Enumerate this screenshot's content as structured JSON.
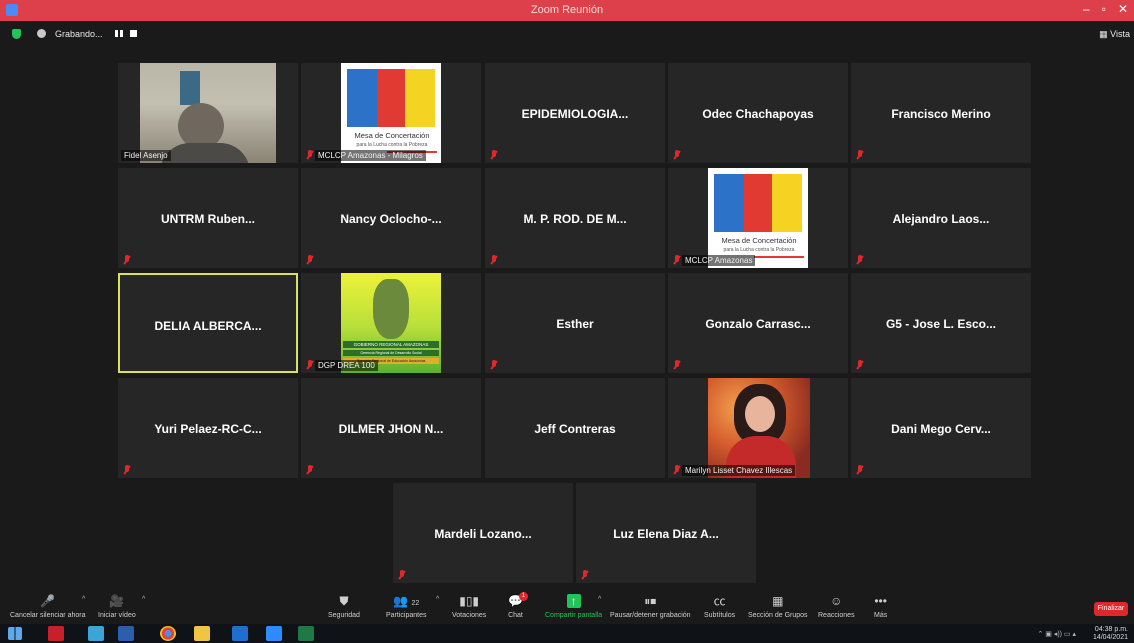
{
  "window": {
    "title": "Zoom Reunión",
    "controls": [
      "–",
      "▫",
      "✕"
    ]
  },
  "topbar": {
    "recording_text": "Grabando...",
    "view_label": "Vista"
  },
  "tiles": [
    {
      "id": "fidel",
      "type": "video",
      "label": "Fidel Asenjo",
      "muted": false
    },
    {
      "id": "mclcp-milagros",
      "type": "logo-mesa",
      "label": "MCLCP Amazonas - Milagros",
      "muted": true
    },
    {
      "id": "epidemiologia",
      "type": "name",
      "name": "EPIDEMIOLOGIA...",
      "muted": true
    },
    {
      "id": "odec",
      "type": "name",
      "name": "Odec Chachapoyas",
      "muted": true
    },
    {
      "id": "francisco",
      "type": "name",
      "name": "Francisco Merino",
      "muted": true
    },
    {
      "id": "untrm",
      "type": "name",
      "name": "UNTRM Ruben...",
      "muted": true
    },
    {
      "id": "nancy",
      "type": "name",
      "name": "Nancy Oclocho-...",
      "muted": true
    },
    {
      "id": "mprod",
      "type": "name",
      "name": "M. P. ROD. DE M...",
      "muted": true
    },
    {
      "id": "mclcp-amazonas",
      "type": "logo-mesa",
      "label": "MCLCP Amazonas",
      "muted": true
    },
    {
      "id": "alejandro",
      "type": "name",
      "name": "Alejandro Laos...",
      "muted": true
    },
    {
      "id": "delia",
      "type": "name",
      "name": "DELIA ALBERCA...",
      "muted": false,
      "active": true
    },
    {
      "id": "dgp",
      "type": "logo-gob",
      "label": "DGP DREA 100",
      "muted": true
    },
    {
      "id": "esther",
      "type": "name",
      "name": "Esther",
      "muted": true
    },
    {
      "id": "gonzalo",
      "type": "name",
      "name": "Gonzalo Carrasc...",
      "muted": true
    },
    {
      "id": "g5",
      "type": "name",
      "name": "G5 - Jose L. Esco...",
      "muted": true
    },
    {
      "id": "yuri",
      "type": "name",
      "name": "Yuri Pelaez-RC-C...",
      "muted": true
    },
    {
      "id": "dilmer",
      "type": "name",
      "name": "DILMER JHON N...",
      "muted": true
    },
    {
      "id": "jeff",
      "type": "name",
      "name": "Jeff Contreras",
      "muted": false
    },
    {
      "id": "marilyn",
      "type": "selfie",
      "label": "Marilyn Lisset Chavez Illescas",
      "muted": true
    },
    {
      "id": "dani",
      "type": "name",
      "name": "Dani Mego Cerv...",
      "muted": true
    },
    {
      "id": "mardeli",
      "type": "name",
      "name": "Mardeli Lozano...",
      "muted": true
    },
    {
      "id": "luz",
      "type": "name",
      "name": "Luz Elena Diaz A...",
      "muted": true
    }
  ],
  "logos": {
    "mesa_title": "Mesa de Concertación",
    "mesa_sub": "para la Lucha contra la Pobreza",
    "gob_line1": "GOBIERNO REGIONAL AMAZONAS",
    "gob_line2": "Gerencia Regional de Desarrollo Social",
    "gob_line3": "Dirección Regional de Educación Amazonas"
  },
  "toolbar": {
    "unmute": "Cancelar silenciar ahora",
    "video": "Iniciar vídeo",
    "security": "Seguridad",
    "participants": "Participantes",
    "participants_count": "22",
    "polls": "Votaciones",
    "chat": "Chat",
    "chat_badge": "1",
    "share": "Compartir pantalla",
    "record": "Pausar/detener grabación",
    "captions": "Subtítulos",
    "breakout": "Sección de Grupos",
    "reactions": "Reacciones",
    "more": "Más",
    "end": "Finalizar"
  },
  "taskbar": {
    "time": "04:38 p.m.",
    "date": "14/04/2021",
    "app_labels": [
      "Adobe Acrobat",
      "Media Player",
      "Word",
      "Chrome",
      "File Explorer",
      "Outlook",
      "Zoom",
      "Excel"
    ]
  },
  "colors": {
    "titlebar": "#dd3f4b",
    "active_border": "#d7e35c",
    "mute_red": "#e0282a",
    "share_green": "#23c35c"
  }
}
